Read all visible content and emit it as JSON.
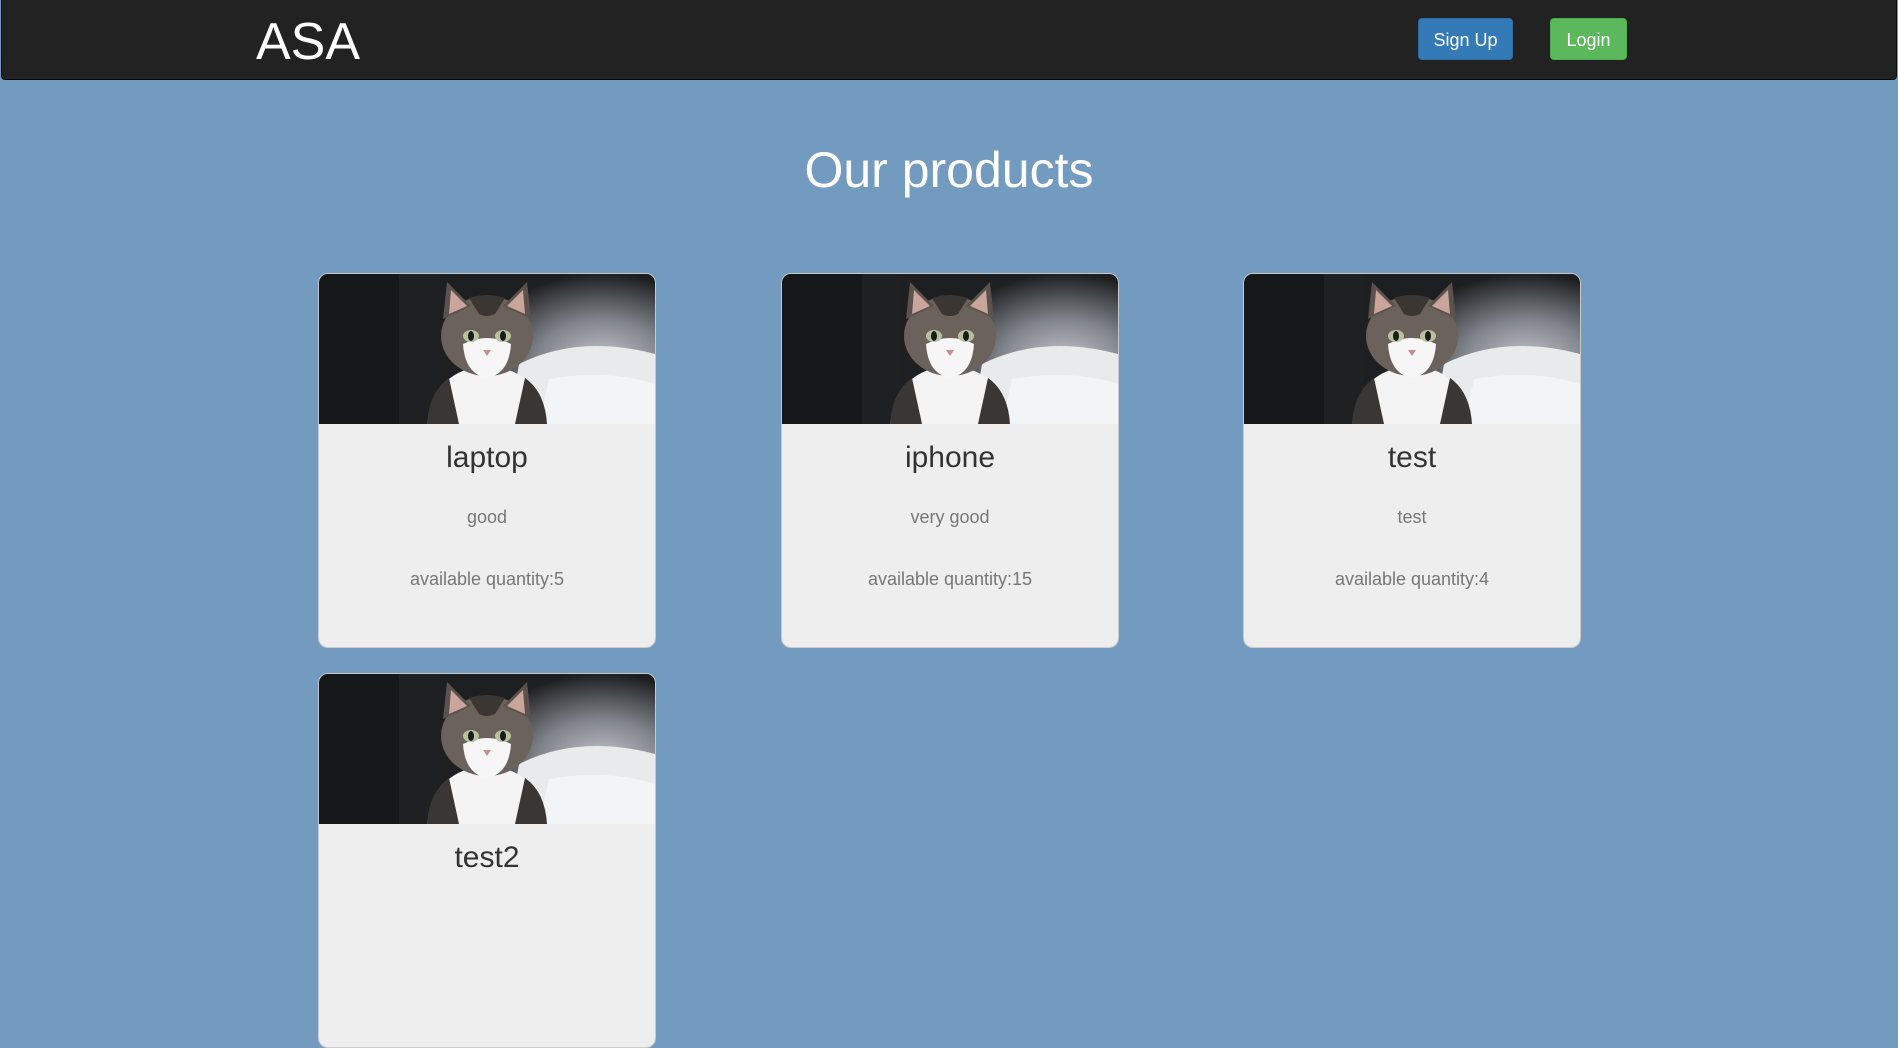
{
  "navbar": {
    "brand": "ASA",
    "signup_label": "Sign Up",
    "login_label": "Login"
  },
  "main": {
    "title": "Our products"
  },
  "products": [
    {
      "name": "laptop",
      "description": "good",
      "quantity": "available quantity:5",
      "image": "cat-photo"
    },
    {
      "name": "iphone",
      "description": "very good",
      "quantity": "available quantity:15",
      "image": "cat-photo"
    },
    {
      "name": "test",
      "description": "test",
      "quantity": "available quantity:4",
      "image": "cat-photo"
    },
    {
      "name": "test2",
      "description": "",
      "quantity": "",
      "image": "cat-photo"
    }
  ],
  "colors": {
    "background": "#729bbf",
    "navbar": "#222222",
    "signup": "#337ab7",
    "login": "#5cb85c",
    "card": "#eeeeee"
  }
}
